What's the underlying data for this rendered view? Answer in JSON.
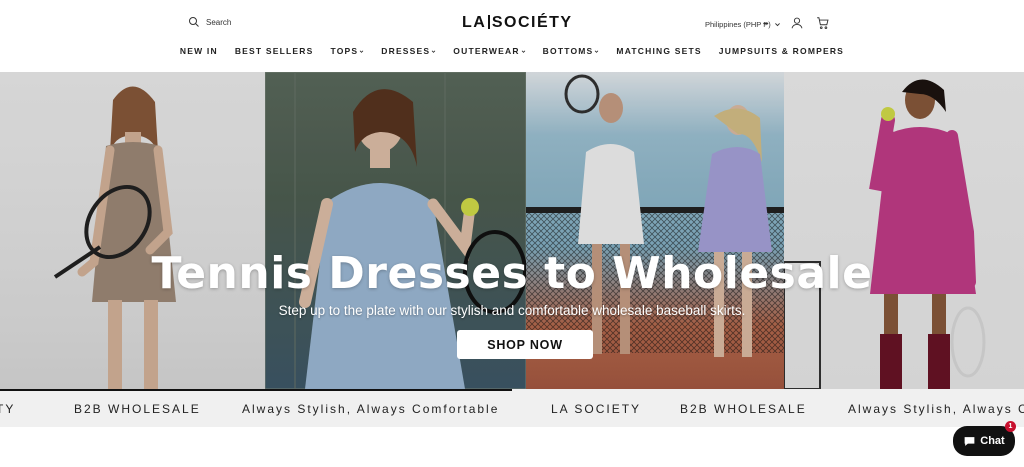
{
  "header": {
    "search_label": "Search",
    "logo_left": "LA",
    "logo_right": "SOCIÉTY",
    "country": "Philippines (PHP ₱)",
    "icons": {
      "search": "search-icon",
      "account": "account-icon",
      "cart": "cart-icon"
    }
  },
  "nav": {
    "items": [
      {
        "label": "NEW IN",
        "dropdown": false
      },
      {
        "label": "BEST SELLERS",
        "dropdown": false
      },
      {
        "label": "TOPS",
        "dropdown": true
      },
      {
        "label": "DRESSES",
        "dropdown": true
      },
      {
        "label": "OUTERWEAR",
        "dropdown": true
      },
      {
        "label": "BOTTOMS",
        "dropdown": true
      },
      {
        "label": "MATCHING SETS",
        "dropdown": false
      },
      {
        "label": "JUMPSUITS & ROMPERS",
        "dropdown": false
      }
    ]
  },
  "hero": {
    "title": "Tennis Dresses to Wholesale",
    "subtitle": "Step up to the plate with our stylish and comfortable wholesale baseball skirts.",
    "cta": "SHOP NOW"
  },
  "marquee": {
    "items": [
      "ETY",
      "B2B WHOLESALE",
      "Always Stylish, Always Comfortable",
      "LA SOCIETY",
      "B2B WHOLESALE",
      "Always Stylish, Always C"
    ]
  },
  "chat": {
    "label": "Chat",
    "badge": "1"
  },
  "colors": {
    "accent": "#111111",
    "badge": "#c8102e",
    "marquee_bg": "#f0f0f0"
  }
}
